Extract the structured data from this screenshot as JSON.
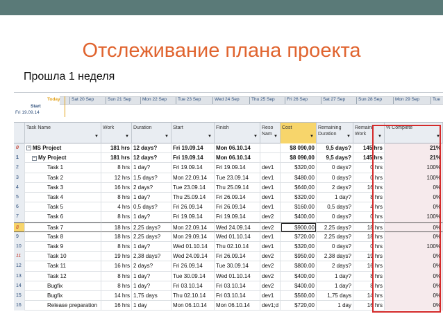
{
  "slide": {
    "title": "Отслеживание плана проекта",
    "subtitle": "Прошла 1 неделя",
    "accent_color": "#e0642f",
    "topbar_color": "#5a7a78"
  },
  "timeline": {
    "today_label": "Today",
    "start_label": "Start",
    "start_date": "Fri 19.09.14",
    "dates": [
      "Sat 20 Sep",
      "Sun 21 Sep",
      "Mon 22 Sep",
      "Tue 23 Sep",
      "Wed 24 Sep",
      "Thu 25 Sep",
      "Fri 26 Sep",
      "Sat 27 Sep",
      "Sun 28 Sep",
      "Mon 29 Sep",
      "Tue"
    ]
  },
  "columns": {
    "task_name": "Task Name",
    "work": "Work",
    "duration": "Duration",
    "start": "Start",
    "finish": "Finish",
    "resource": "Reso\nNam",
    "cost": "Cost",
    "remaining_duration": "Remaining\nDuration",
    "remaining_work": "Remaini\nWork",
    "pct_complete": "% Complete"
  },
  "rows": [
    {
      "id": "0",
      "name": "MS Project",
      "work": "181 hrs",
      "dur": "12 days?",
      "start": "Fri 19.09.14",
      "finish": "Mon 06.10.14",
      "res": "",
      "cost": "$8 090,00",
      "rdur": "9,5 days?",
      "rwork": "145 hrs",
      "pct": "21%",
      "level": 0,
      "bold": true
    },
    {
      "id": "1",
      "name": "My Project",
      "work": "181 hrs",
      "dur": "12 days?",
      "start": "Fri 19.09.14",
      "finish": "Mon 06.10.14",
      "res": "",
      "cost": "$8 090,00",
      "rdur": "9,5 days?",
      "rwork": "145 hrs",
      "pct": "21%",
      "level": 1,
      "bold": true
    },
    {
      "id": "2",
      "name": "Task 1",
      "work": "8 hrs",
      "dur": "1 day?",
      "start": "Fri 19.09.14",
      "finish": "Fri 19.09.14",
      "res": "dev1",
      "cost": "$320,00",
      "rdur": "0 days?",
      "rwork": "0 hrs",
      "pct": "100%",
      "level": 2
    },
    {
      "id": "3",
      "name": "Task 2",
      "work": "12 hrs",
      "dur": "1,5 days?",
      "start": "Mon 22.09.14",
      "finish": "Tue 23.09.14",
      "res": "dev1",
      "cost": "$480,00",
      "rdur": "0 days?",
      "rwork": "0 hrs",
      "pct": "100%",
      "level": 2
    },
    {
      "id": "4",
      "name": "Task 3",
      "work": "16 hrs",
      "dur": "2 days?",
      "start": "Tue 23.09.14",
      "finish": "Thu 25.09.14",
      "res": "dev1",
      "cost": "$640,00",
      "rdur": "2 days?",
      "rwork": "16 hrs",
      "pct": "0%",
      "level": 2
    },
    {
      "id": "5",
      "name": "Task 4",
      "work": "8 hrs",
      "dur": "1 day?",
      "start": "Thu 25.09.14",
      "finish": "Fri 26.09.14",
      "res": "dev1",
      "cost": "$320,00",
      "rdur": "1 day?",
      "rwork": "8 hrs",
      "pct": "0%",
      "level": 2
    },
    {
      "id": "6",
      "name": "Task 5",
      "work": "4 hrs",
      "dur": "0,5 days?",
      "start": "Fri 26.09.14",
      "finish": "Fri 26.09.14",
      "res": "dev1",
      "cost": "$160,00",
      "rdur": "0,5 days?",
      "rwork": "4 hrs",
      "pct": "0%",
      "level": 2
    },
    {
      "id": "7",
      "name": "Task 6",
      "work": "8 hrs",
      "dur": "1 day?",
      "start": "Fri 19.09.14",
      "finish": "Fri 19.09.14",
      "res": "dev2",
      "cost": "$400,00",
      "rdur": "0 days?",
      "rwork": "0 hrs",
      "pct": "100%",
      "level": 2
    },
    {
      "id": "8",
      "name": "Task 7",
      "work": "18 hrs",
      "dur": "2,25 days?",
      "start": "Mon 22.09.14",
      "finish": "Wed 24.09.14",
      "res": "dev2",
      "cost": "$900,00",
      "rdur": "2,25 days?",
      "rwork": "18 hrs",
      "pct": "0%",
      "level": 2,
      "selected": true
    },
    {
      "id": "9",
      "name": "Task 8",
      "work": "18 hrs",
      "dur": "2,25 days?",
      "start": "Mon 29.09.14",
      "finish": "Wed 01.10.14",
      "res": "dev1",
      "cost": "$720,00",
      "rdur": "2,25 days?",
      "rwork": "18 hrs",
      "pct": "0%",
      "level": 2
    },
    {
      "id": "10",
      "name": "Task 9",
      "work": "8 hrs",
      "dur": "1 day?",
      "start": "Wed 01.10.14",
      "finish": "Thu 02.10.14",
      "res": "dev1",
      "cost": "$320,00",
      "rdur": "0 days?",
      "rwork": "0 hrs",
      "pct": "100%",
      "level": 2
    },
    {
      "id": "11",
      "name": "Task 10",
      "work": "19 hrs",
      "dur": "2,38 days?",
      "start": "Wed 24.09.14",
      "finish": "Fri 26.09.14",
      "res": "dev2",
      "cost": "$950,00",
      "rdur": "2,38 days?",
      "rwork": "19 hrs",
      "pct": "0%",
      "level": 2
    },
    {
      "id": "12",
      "name": "Task 11",
      "work": "16 hrs",
      "dur": "2 days?",
      "start": "Fri 26.09.14",
      "finish": "Tue 30.09.14",
      "res": "dev2",
      "cost": "$800,00",
      "rdur": "2 days?",
      "rwork": "16 hrs",
      "pct": "0%",
      "level": 2
    },
    {
      "id": "13",
      "name": "Task 12",
      "work": "8 hrs",
      "dur": "1 day?",
      "start": "Tue 30.09.14",
      "finish": "Wed 01.10.14",
      "res": "dev2",
      "cost": "$400,00",
      "rdur": "1 day?",
      "rwork": "8 hrs",
      "pct": "0%",
      "level": 2
    },
    {
      "id": "14",
      "name": "Bugfix",
      "work": "8 hrs",
      "dur": "1 day?",
      "start": "Fri 03.10.14",
      "finish": "Fri 03.10.14",
      "res": "dev2",
      "cost": "$400,00",
      "rdur": "1 day?",
      "rwork": "8 hrs",
      "pct": "0%",
      "level": 2
    },
    {
      "id": "15",
      "name": "Bugfix",
      "work": "14 hrs",
      "dur": "1,75 days",
      "start": "Thu 02.10.14",
      "finish": "Fri 03.10.14",
      "res": "dev1",
      "cost": "$560,00",
      "rdur": "1,75 days",
      "rwork": "14 hrs",
      "pct": "0%",
      "level": 2
    },
    {
      "id": "16",
      "name": "Release preparation",
      "work": "16 hrs",
      "dur": "1 day",
      "start": "Mon 06.10.14",
      "finish": "Mon 06.10.14",
      "res": "dev1;d",
      "cost": "$720,00",
      "rdur": "1 day",
      "rwork": "16 hrs",
      "pct": "0%",
      "level": 2
    }
  ]
}
